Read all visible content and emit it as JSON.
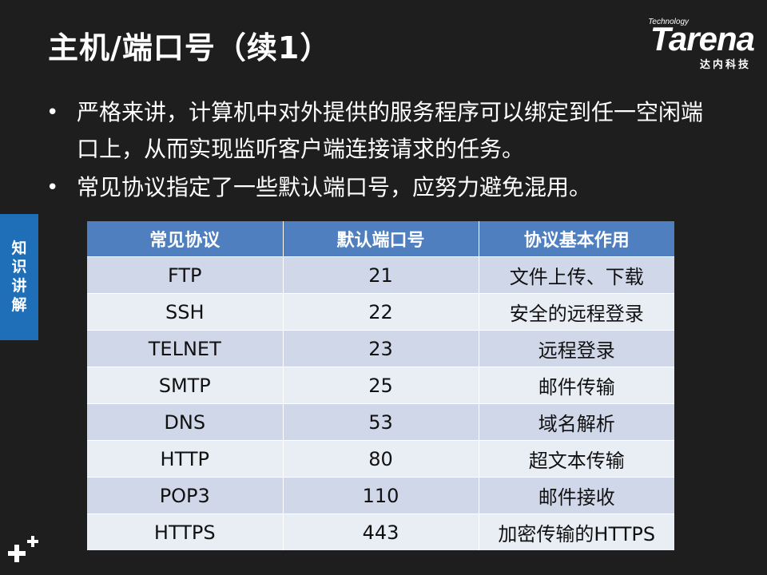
{
  "title": "主机/端口号（续1）",
  "logo": {
    "top_text": "Technology",
    "brand": "Tarena",
    "subtitle": "达内科技"
  },
  "bullets": [
    "严格来讲，计算机中对外提供的服务程序可以绑定到任一空闲端口上，从而实现监听客户端连接请求的任务。",
    "常见协议指定了一些默认端口号，应努力避免混用。"
  ],
  "bullet_symbol": "•",
  "side_tab": {
    "chars": [
      "知",
      "识",
      "讲",
      "解"
    ]
  },
  "table": {
    "headers": [
      "常见协议",
      "默认端口号",
      "协议基本作用"
    ],
    "rows": [
      [
        "FTP",
        "21",
        "文件上传、下载"
      ],
      [
        "SSH",
        "22",
        "安全的远程登录"
      ],
      [
        "TELNET",
        "23",
        "远程登录"
      ],
      [
        "SMTP",
        "25",
        "邮件传输"
      ],
      [
        "DNS",
        "53",
        "域名解析"
      ],
      [
        "HTTP",
        "80",
        "超文本传输"
      ],
      [
        "POP3",
        "110",
        "邮件接收"
      ],
      [
        "HTTPS",
        "443",
        "加密传输的HTTPS"
      ]
    ]
  },
  "colors": {
    "background": "#1e1e1e",
    "header_blue": "#4f7fbe",
    "tab_blue": "#1f6fb8",
    "row_odd": "#cfd7e8",
    "row_even": "#e9edf4"
  },
  "icons": {
    "corner": "plus-plus-icon"
  }
}
